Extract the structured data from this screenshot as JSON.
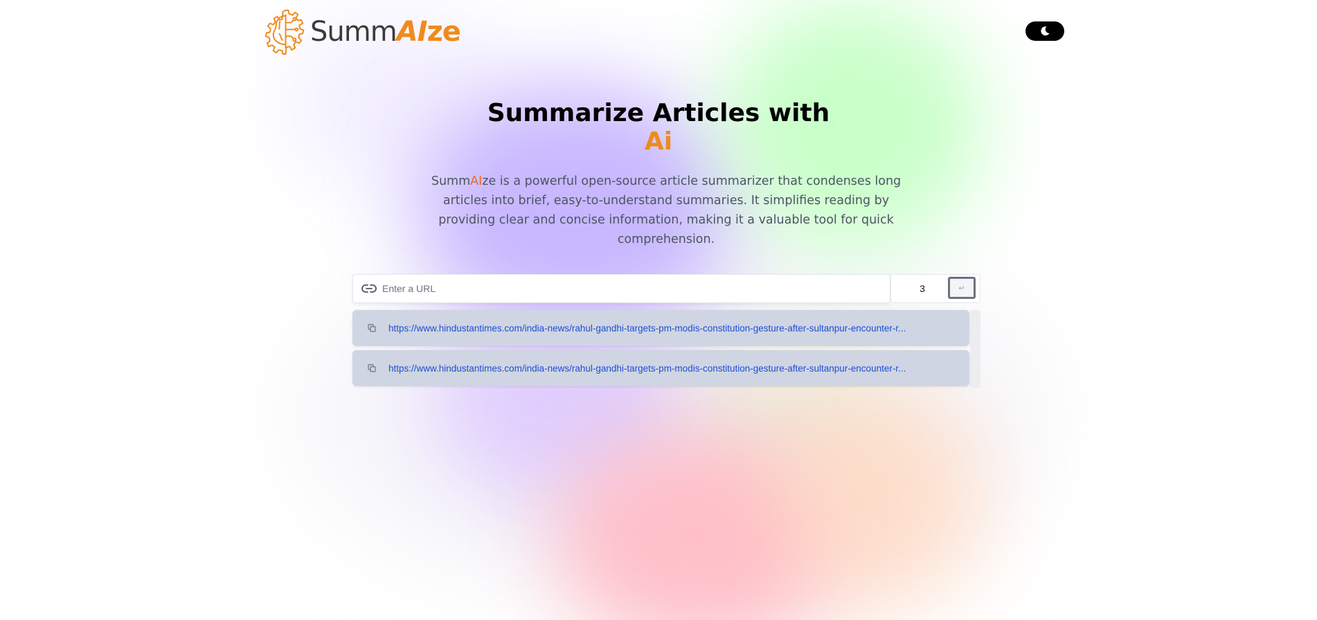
{
  "brand": {
    "name_prefix": "Summ",
    "name_ai": "AI",
    "name_suffix": "ze"
  },
  "header": {
    "theme_toggle_icon": "moon-icon"
  },
  "hero": {
    "title_line1": "Summarize Articles with",
    "title_accent": "Ai"
  },
  "description": {
    "part1": "Summ",
    "part2": "AI",
    "part3": "ze is a powerful open-source article summarizer that condenses long articles into brief, easy-to-understand summaries. It simplifies reading by providing clear and concise information, making it a valuable tool for quick comprehension."
  },
  "form": {
    "url_placeholder": "Enter a URL",
    "url_value": "",
    "count_value": "3",
    "submit_icon": "↵"
  },
  "history": [
    {
      "url": "https://www.hindustantimes.com/india-news/rahul-gandhi-targets-pm-modis-constitution-gesture-after-sultanpur-encounter-r..."
    },
    {
      "url": "https://www.hindustantimes.com/india-news/rahul-gandhi-targets-pm-modis-constitution-gesture-after-sultanpur-encounter-r..."
    }
  ],
  "colors": {
    "accent": "#f08a1c",
    "link": "#1d4ed8",
    "history_bg": "#cfd5e2"
  }
}
